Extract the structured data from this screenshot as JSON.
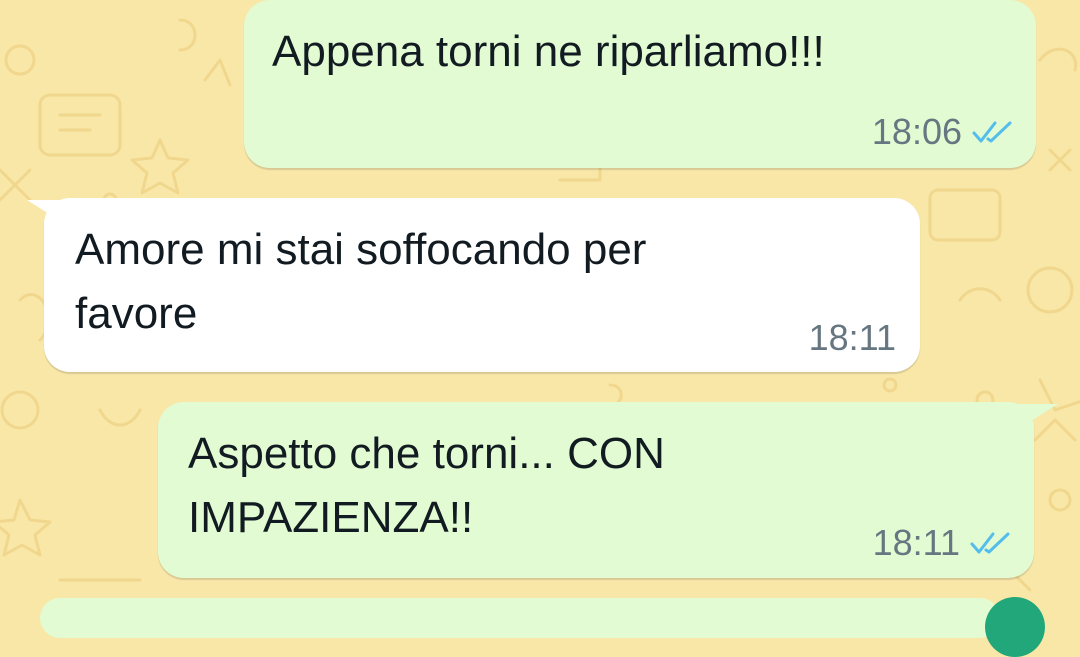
{
  "colors": {
    "wallpaper": "#f9e7a8",
    "outgoing_bubble": "#e2fbd2",
    "incoming_bubble": "#ffffff",
    "read_tick": "#53bdeb",
    "time_text": "#667781"
  },
  "messages": [
    {
      "direction": "outgoing",
      "text": "Appena torni ne riparliamo!!!",
      "time": "18:06",
      "status_icon": "double-check-read-icon"
    },
    {
      "direction": "incoming",
      "text": "Amore mi stai soffocando per\nfavore",
      "time": "18:11"
    },
    {
      "direction": "outgoing",
      "text": "Aspetto che torni... CON\nIMPAZIENZA!!",
      "time": "18:11",
      "status_icon": "double-check-read-icon"
    }
  ]
}
